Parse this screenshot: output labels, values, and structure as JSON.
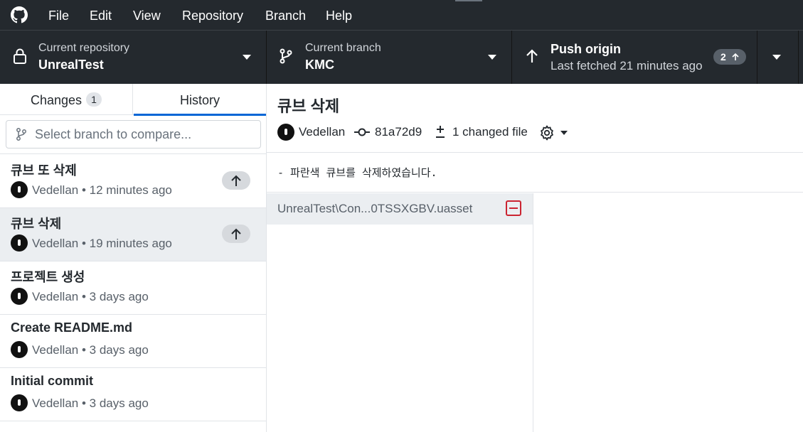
{
  "menu": {
    "items": [
      "File",
      "Edit",
      "View",
      "Repository",
      "Branch",
      "Help"
    ]
  },
  "toolbar": {
    "repository": {
      "title": "Current repository",
      "value": "UnrealTest"
    },
    "branch": {
      "title": "Current branch",
      "value": "KMC"
    },
    "push": {
      "title": "Push origin",
      "subtitle": "Last fetched 21 minutes ago",
      "ahead_count": "2"
    }
  },
  "sidebar": {
    "tabs": {
      "changes": "Changes",
      "changes_count": "1",
      "history": "History"
    },
    "compare": {
      "placeholder": "Select branch to compare..."
    },
    "commits": [
      {
        "summary": "큐브 또 삭제",
        "author": "Vedellan",
        "time": "12 minutes ago",
        "unpushed": true
      },
      {
        "summary": "큐브 삭제",
        "author": "Vedellan",
        "time": "19 minutes ago",
        "unpushed": true,
        "selected": true
      },
      {
        "summary": "프로젝트 생성",
        "author": "Vedellan",
        "time": "3 days ago",
        "unpushed": false
      },
      {
        "summary": "Create README.md",
        "author": "Vedellan",
        "time": "3 days ago",
        "unpushed": false
      },
      {
        "summary": "Initial commit",
        "author": "Vedellan",
        "time": "3 days ago",
        "unpushed": false
      }
    ]
  },
  "details": {
    "title": "큐브 삭제",
    "author": "Vedellan",
    "sha": "81a72d9",
    "changed_files": "1 changed file",
    "description": "- 파란색 큐브를 삭제하였습니다.",
    "files": [
      {
        "path": "UnrealTest\\Con...0TSSXGBV.uasset",
        "status": "deleted"
      }
    ]
  },
  "colors": {
    "chrome": "#24292e",
    "accent": "#0366d6",
    "deleted": "#cb2431",
    "selected_row": "#ebeef1"
  }
}
